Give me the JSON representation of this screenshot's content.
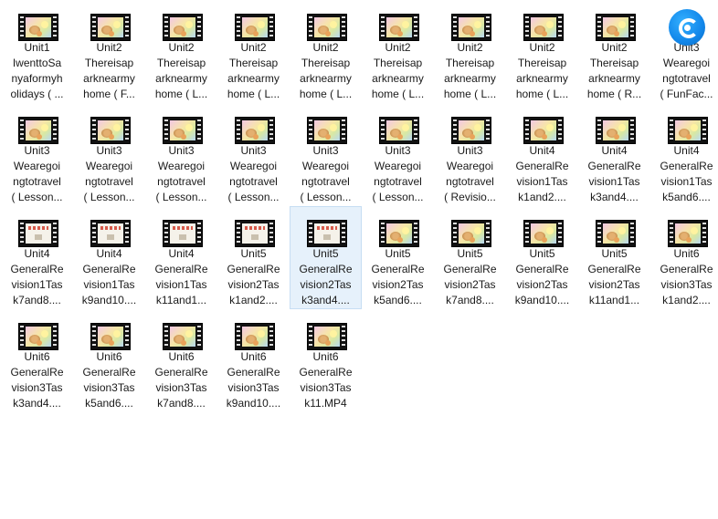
{
  "files": [
    {
      "lines": [
        "Unit1",
        "IwenttoSa",
        "nyaformyh",
        "olidays ( ..."
      ],
      "icon": "film-icon",
      "thumb": "cartoon"
    },
    {
      "lines": [
        "Unit2",
        "Thereisap",
        "arknearmy",
        "home ( F..."
      ],
      "icon": "film-icon",
      "thumb": "cartoon"
    },
    {
      "lines": [
        "Unit2",
        "Thereisap",
        "arknearmy",
        "home ( L..."
      ],
      "icon": "film-icon",
      "thumb": "cartoon"
    },
    {
      "lines": [
        "Unit2",
        "Thereisap",
        "arknearmy",
        "home ( L..."
      ],
      "icon": "film-icon",
      "thumb": "cartoon"
    },
    {
      "lines": [
        "Unit2",
        "Thereisap",
        "arknearmy",
        "home ( L..."
      ],
      "icon": "film-icon",
      "thumb": "cartoon"
    },
    {
      "lines": [
        "Unit2",
        "Thereisap",
        "arknearmy",
        "home ( L..."
      ],
      "icon": "film-icon",
      "thumb": "cartoon"
    },
    {
      "lines": [
        "Unit2",
        "Thereisap",
        "arknearmy",
        "home ( L..."
      ],
      "icon": "film-icon",
      "thumb": "cartoon"
    },
    {
      "lines": [
        "Unit2",
        "Thereisap",
        "arknearmy",
        "home ( L..."
      ],
      "icon": "film-icon",
      "thumb": "cartoon"
    },
    {
      "lines": [
        "Unit2",
        "Thereisap",
        "arknearmy",
        "home ( R..."
      ],
      "icon": "film-icon",
      "thumb": "cartoon"
    },
    {
      "lines": [
        "Unit3",
        "Wearegoi",
        "ngtotravel",
        "( FunFac..."
      ],
      "icon": "player-app-icon",
      "thumb": "app"
    },
    {
      "lines": [
        "Unit3",
        "Wearegoi",
        "ngtotravel",
        "( Lesson..."
      ],
      "icon": "film-icon",
      "thumb": "cartoon"
    },
    {
      "lines": [
        "Unit3",
        "Wearegoi",
        "ngtotravel",
        "( Lesson..."
      ],
      "icon": "film-icon",
      "thumb": "cartoon"
    },
    {
      "lines": [
        "Unit3",
        "Wearegoi",
        "ngtotravel",
        "( Lesson..."
      ],
      "icon": "film-icon",
      "thumb": "cartoon"
    },
    {
      "lines": [
        "Unit3",
        "Wearegoi",
        "ngtotravel",
        "( Lesson..."
      ],
      "icon": "film-icon",
      "thumb": "cartoon"
    },
    {
      "lines": [
        "Unit3",
        "Wearegoi",
        "ngtotravel",
        "( Lesson..."
      ],
      "icon": "film-icon",
      "thumb": "cartoon"
    },
    {
      "lines": [
        "Unit3",
        "Wearegoi",
        "ngtotravel",
        "( Lesson..."
      ],
      "icon": "film-icon",
      "thumb": "cartoon"
    },
    {
      "lines": [
        "Unit3",
        "Wearegoi",
        "ngtotravel",
        "( Revisio..."
      ],
      "icon": "film-icon",
      "thumb": "cartoon"
    },
    {
      "lines": [
        "Unit4",
        "GeneralRe",
        "vision1Tas",
        "k1and2...."
      ],
      "icon": "film-icon",
      "thumb": "cartoon"
    },
    {
      "lines": [
        "Unit4",
        "GeneralRe",
        "vision1Tas",
        "k3and4...."
      ],
      "icon": "film-icon",
      "thumb": "cartoon"
    },
    {
      "lines": [
        "Unit4",
        "GeneralRe",
        "vision1Tas",
        "k5and6...."
      ],
      "icon": "film-icon",
      "thumb": "cartoon"
    },
    {
      "lines": [
        "Unit4",
        "GeneralRe",
        "vision1Tas",
        "k7and8...."
      ],
      "icon": "film-icon",
      "thumb": "screen"
    },
    {
      "lines": [
        "Unit4",
        "GeneralRe",
        "vision1Tas",
        "k9and10...."
      ],
      "icon": "film-icon",
      "thumb": "screen"
    },
    {
      "lines": [
        "Unit4",
        "GeneralRe",
        "vision1Tas",
        "k11and1..."
      ],
      "icon": "film-icon",
      "thumb": "screen"
    },
    {
      "lines": [
        "Unit5",
        "GeneralRe",
        "vision2Tas",
        "k1and2...."
      ],
      "icon": "film-icon",
      "thumb": "screen"
    },
    {
      "lines": [
        "Unit5",
        "GeneralRe",
        "vision2Tas",
        "k3and4...."
      ],
      "icon": "film-icon",
      "thumb": "screen",
      "selected": true
    },
    {
      "lines": [
        "Unit5",
        "GeneralRe",
        "vision2Tas",
        "k5and6...."
      ],
      "icon": "film-icon",
      "thumb": "cartoon"
    },
    {
      "lines": [
        "Unit5",
        "GeneralRe",
        "vision2Tas",
        "k7and8...."
      ],
      "icon": "film-icon",
      "thumb": "cartoon"
    },
    {
      "lines": [
        "Unit5",
        "GeneralRe",
        "vision2Tas",
        "k9and10...."
      ],
      "icon": "film-icon",
      "thumb": "cartoon"
    },
    {
      "lines": [
        "Unit5",
        "GeneralRe",
        "vision2Tas",
        "k11and1..."
      ],
      "icon": "film-icon",
      "thumb": "cartoon"
    },
    {
      "lines": [
        "Unit6",
        "GeneralRe",
        "vision3Tas",
        "k1and2...."
      ],
      "icon": "film-icon",
      "thumb": "cartoon"
    },
    {
      "lines": [
        "Unit6",
        "GeneralRe",
        "vision3Tas",
        "k3and4...."
      ],
      "icon": "film-icon",
      "thumb": "cartoon"
    },
    {
      "lines": [
        "Unit6",
        "GeneralRe",
        "vision3Tas",
        "k5and6...."
      ],
      "icon": "film-icon",
      "thumb": "cartoon"
    },
    {
      "lines": [
        "Unit6",
        "GeneralRe",
        "vision3Tas",
        "k7and8...."
      ],
      "icon": "film-icon",
      "thumb": "cartoon"
    },
    {
      "lines": [
        "Unit6",
        "GeneralRe",
        "vision3Tas",
        "k9and10...."
      ],
      "icon": "film-icon",
      "thumb": "cartoon"
    },
    {
      "lines": [
        "Unit6",
        "GeneralRe",
        "vision3Tas",
        "k11.MP4"
      ],
      "icon": "film-icon",
      "thumb": "cartoon"
    }
  ]
}
